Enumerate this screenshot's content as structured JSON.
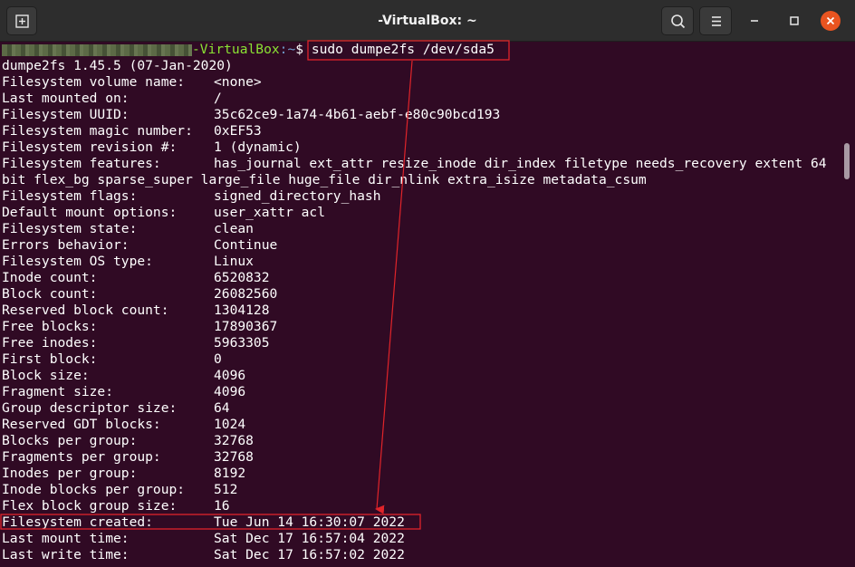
{
  "window": {
    "title": "-VirtualBox: ~"
  },
  "titlebar": {
    "icons": [
      "new-tab-icon",
      "search-icon",
      "hamburger-menu-icon",
      "minimize-icon",
      "maximize-icon",
      "close-icon"
    ]
  },
  "prompt": {
    "host": "-VirtualBox",
    "path": ":~",
    "symbol": "$ ",
    "command": "sudo dumpe2fs /dev/sda5"
  },
  "version_line": "dumpe2fs 1.45.5 (07-Jan-2020)",
  "fields": [
    {
      "key": "Filesystem volume name:",
      "value": "<none>"
    },
    {
      "key": "Last mounted on:",
      "value": "/"
    },
    {
      "key": "Filesystem UUID:",
      "value": "35c62ce9-1a74-4b61-aebf-e80c90bcd193"
    },
    {
      "key": "Filesystem magic number:",
      "value": "0xEF53"
    },
    {
      "key": "Filesystem revision #:",
      "value": "1 (dynamic)"
    },
    {
      "key": "Filesystem features:",
      "value": "has_journal ext_attr resize_inode dir_index filetype needs_recovery extent 64"
    },
    {
      "key": "",
      "value": "bit flex_bg sparse_super large_file huge_file dir_nlink extra_isize metadata_csum"
    },
    {
      "key": "Filesystem flags:",
      "value": "signed_directory_hash"
    },
    {
      "key": "Default mount options:",
      "value": "user_xattr acl"
    },
    {
      "key": "Filesystem state:",
      "value": "clean"
    },
    {
      "key": "Errors behavior:",
      "value": "Continue"
    },
    {
      "key": "Filesystem OS type:",
      "value": "Linux"
    },
    {
      "key": "Inode count:",
      "value": "6520832"
    },
    {
      "key": "Block count:",
      "value": "26082560"
    },
    {
      "key": "Reserved block count:",
      "value": "1304128"
    },
    {
      "key": "Free blocks:",
      "value": "17890367"
    },
    {
      "key": "Free inodes:",
      "value": "5963305"
    },
    {
      "key": "First block:",
      "value": "0"
    },
    {
      "key": "Block size:",
      "value": "4096"
    },
    {
      "key": "Fragment size:",
      "value": "4096"
    },
    {
      "key": "Group descriptor size:",
      "value": "64"
    },
    {
      "key": "Reserved GDT blocks:",
      "value": "1024"
    },
    {
      "key": "Blocks per group:",
      "value": "32768"
    },
    {
      "key": "Fragments per group:",
      "value": "32768"
    },
    {
      "key": "Inodes per group:",
      "value": "8192"
    },
    {
      "key": "Inode blocks per group:",
      "value": "512"
    },
    {
      "key": "Flex block group size:",
      "value": "16"
    },
    {
      "key": "Filesystem created:",
      "value": "Tue Jun 14 16:30:07 2022"
    },
    {
      "key": "Last mount time:",
      "value": "Sat Dec 17 16:57:04 2022"
    },
    {
      "key": "Last write time:",
      "value": "Sat Dec 17 16:57:02 2022"
    }
  ],
  "colors": {
    "terminal_bg": "#300a24",
    "titlebar_bg": "#2d2d2d",
    "prompt_green": "#8ae234",
    "prompt_blue": "#729fcf",
    "annotation_red": "#e0242a",
    "close_orange": "#e95420"
  }
}
